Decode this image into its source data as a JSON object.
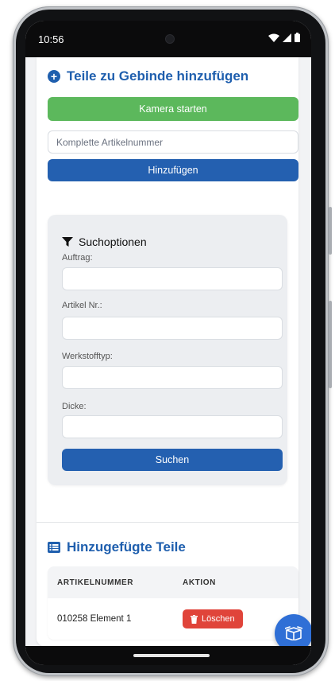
{
  "status_bar": {
    "time": "10:56"
  },
  "add_section": {
    "title": "Teile zu Gebinde hinzufügen",
    "camera_button": "Kamera starten",
    "article_input_placeholder": "Komplette Artikelnummer",
    "add_button": "Hinzufügen"
  },
  "search_options": {
    "title": "Suchoptionen",
    "fields": [
      {
        "label": "Auftrag:",
        "value": ""
      },
      {
        "label": "Artikel Nr.:",
        "value": ""
      },
      {
        "label": "Werkstofftyp:",
        "value": ""
      },
      {
        "label": "Dicke:",
        "value": ""
      }
    ],
    "search_button": "Suchen"
  },
  "added_parts": {
    "title": "Hinzugefügte Teile",
    "columns": [
      "ARTIKELNUMMER",
      "AKTION"
    ],
    "rows": [
      {
        "article": "010258 Element 1",
        "action": "Löschen"
      }
    ]
  },
  "colors": {
    "accent_blue": "#2460b0",
    "green": "#5cb85c",
    "danger": "#e0443a",
    "fab": "#2f6fd6"
  },
  "icons": {
    "title_icon": "plus-circle-icon",
    "filter": "filter-icon",
    "list": "list-icon",
    "delete": "trash-icon",
    "fab": "box-icon"
  }
}
